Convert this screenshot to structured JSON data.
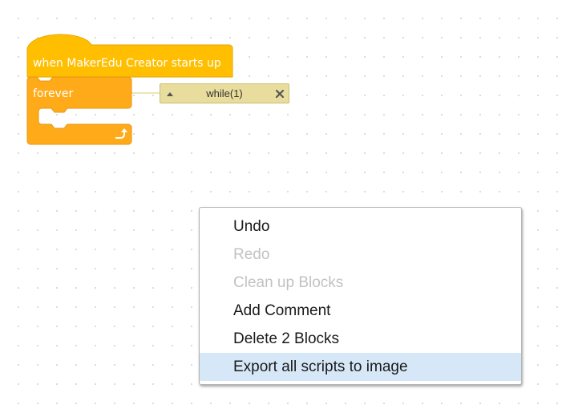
{
  "colors": {
    "event_block": "#ffbf00",
    "control_block": "#ffab19",
    "comment_bg": "#e8dd9c",
    "menu_highlight": "#d6e8f7",
    "menu_disabled_text": "#c2c2c2"
  },
  "blocks": {
    "hat_label": "when MakerEdu Creator starts up",
    "forever_label": "forever",
    "loop_arrow_icon": "loop-arrow-icon"
  },
  "comment": {
    "text": "while(1)",
    "minimize_icon": "triangle-up-icon",
    "delete_icon": "close-x-icon"
  },
  "context_menu": {
    "items": [
      {
        "label": "Undo",
        "enabled": true,
        "highlighted": false
      },
      {
        "label": "Redo",
        "enabled": false,
        "highlighted": false
      },
      {
        "label": "Clean up Blocks",
        "enabled": false,
        "highlighted": false
      },
      {
        "label": "Add Comment",
        "enabled": true,
        "highlighted": false
      },
      {
        "label": "Delete 2 Blocks",
        "enabled": true,
        "highlighted": false
      },
      {
        "label": "Export all scripts to image",
        "enabled": true,
        "highlighted": true
      }
    ]
  }
}
